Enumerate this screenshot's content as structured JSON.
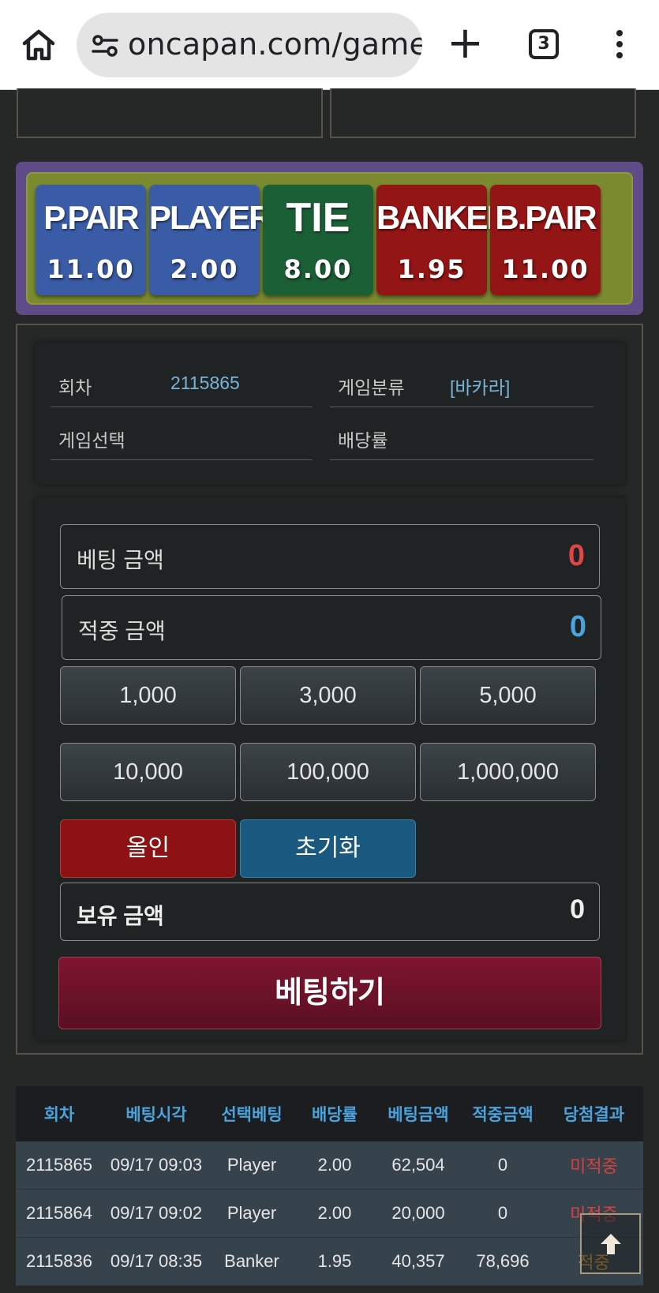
{
  "browser": {
    "url": "oncapan.com/gamezc",
    "tab_count": "3",
    "plus": "+"
  },
  "bet_options": [
    {
      "name": "P.PAIR",
      "odds": "11.00",
      "color": "#3a5ca6"
    },
    {
      "name": "PLAYER",
      "odds": "2.00",
      "color": "#3a5ca6"
    },
    {
      "name": "TIE",
      "odds": "8.00",
      "color": "#1b5f36"
    },
    {
      "name": "BANKER",
      "odds": "1.95",
      "color": "#931515"
    },
    {
      "name": "B.PAIR",
      "odds": "11.00",
      "color": "#931515"
    }
  ],
  "info": {
    "round_label": "회차",
    "round_value": "2115865",
    "category_label": "게임분류",
    "category_value": "[바카라]",
    "selection_label": "게임선택",
    "selection_value": "",
    "odds_label": "배당률",
    "odds_value": ""
  },
  "betting": {
    "bet_amount_label": "베팅 금액",
    "bet_amount_value": "0",
    "win_amount_label": "적중 금액",
    "win_amount_value": "0",
    "chips": [
      "1,000",
      "3,000",
      "5,000",
      "10,000",
      "100,000",
      "1,000,000"
    ],
    "allin_label": "올인",
    "reset_label": "초기화",
    "hold_label": "보유 금액",
    "hold_value": "0",
    "submit_label": "베팅하기"
  },
  "history": {
    "headers": [
      "회차",
      "베팅시각",
      "선택베팅",
      "배당률",
      "베팅금액",
      "적중금액",
      "당첨결과"
    ],
    "rows": [
      [
        "2115865",
        "09/17 09:03",
        "Player",
        "2.00",
        "62,504",
        "0",
        "미적중"
      ],
      [
        "2115864",
        "09/17 09:02",
        "Player",
        "2.00",
        "20,000",
        "0",
        "미적중"
      ],
      [
        "2115836",
        "09/17 08:35",
        "Banker",
        "1.95",
        "40,357",
        "78,696",
        "적중"
      ]
    ]
  },
  "colors": {
    "bet_amount": "#e04646",
    "win_amount": "#4aa3dc",
    "header_text": "#4aa3dc",
    "loss": "#d74040",
    "win": "#d9a020"
  }
}
